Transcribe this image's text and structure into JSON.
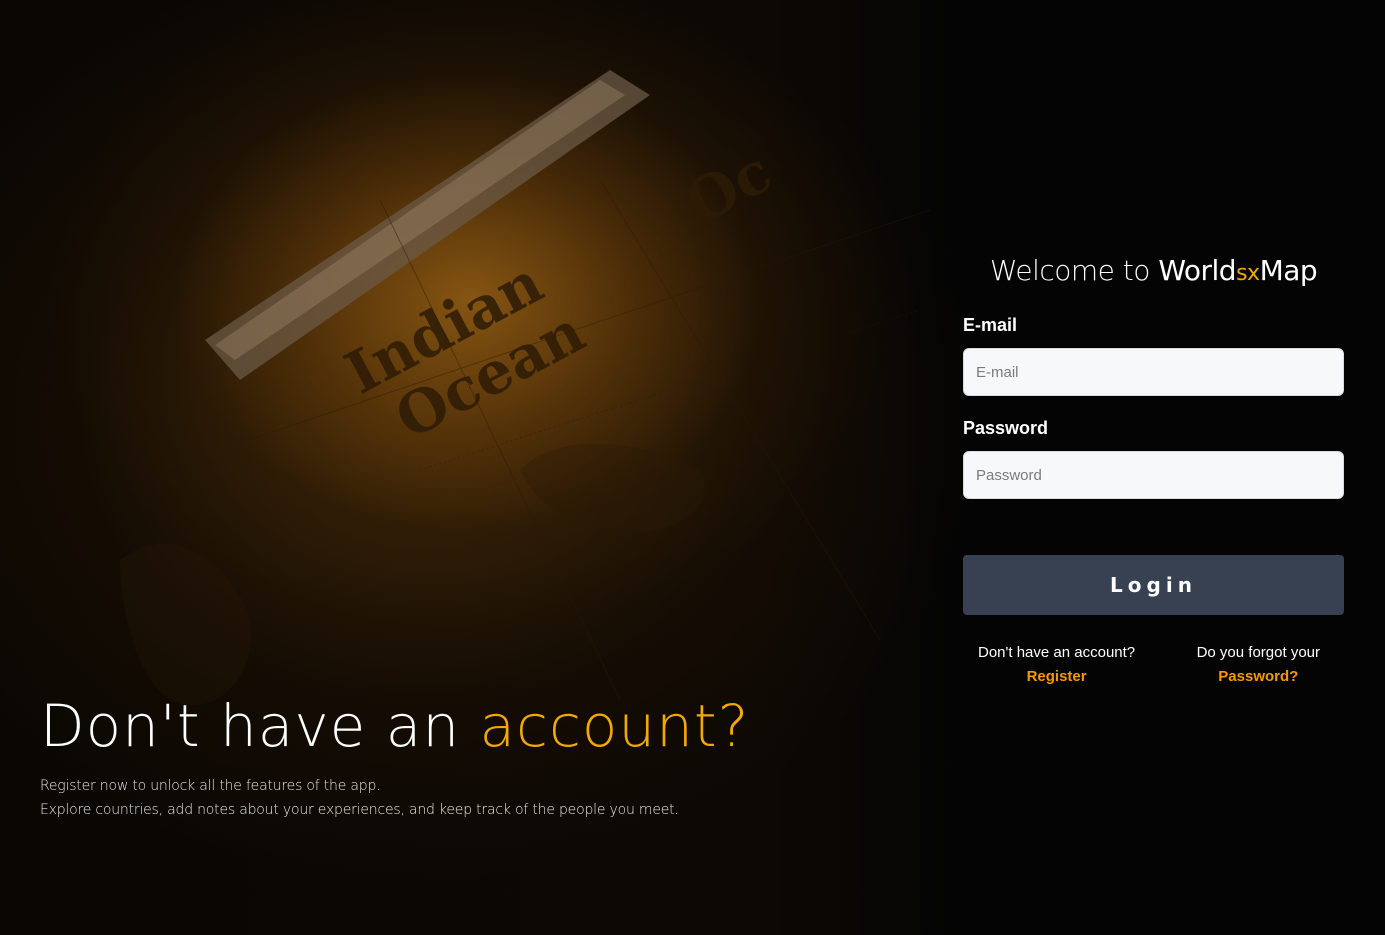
{
  "hero": {
    "title_prefix": "Don't have an ",
    "title_accent": "account?",
    "line1": "Register now to unlock all the features of the app.",
    "line2": "Explore countries, add notes about your experiences, and keep track of the people you meet."
  },
  "map_labels": {
    "indian": "Indian",
    "ocean": "Ocean",
    "oc": "Oc"
  },
  "login": {
    "welcome_prefix": "Welcome to ",
    "brand_world": "World",
    "brand_sx": "sx",
    "brand_map": "Map",
    "email_label": "E-mail",
    "email_placeholder": "E-mail",
    "email_value": "",
    "password_label": "Password",
    "password_placeholder": "Password",
    "password_value": "",
    "login_button": "Login",
    "register_question": "Don't have an account?",
    "register_link": "Register",
    "forgot_question": "Do you forgot your",
    "forgot_link": "Password?"
  },
  "colors": {
    "accent": "#f2a900",
    "link": "#f29b00",
    "button": "#384152",
    "background": "#040404"
  }
}
